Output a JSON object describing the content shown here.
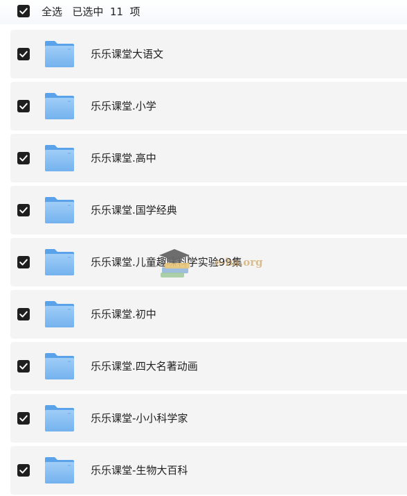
{
  "header": {
    "select_all_label": "全选",
    "selected_text": "已选中  11  项",
    "select_all_checked": true
  },
  "files": [
    {
      "name": "乐乐课堂大语文",
      "checked": true
    },
    {
      "name": "乐乐课堂.小学",
      "checked": true
    },
    {
      "name": "乐乐课堂.高中",
      "checked": true
    },
    {
      "name": "乐乐课堂.国学经典",
      "checked": true
    },
    {
      "name": "乐乐课堂.儿童趣味科学实验99集",
      "checked": true
    },
    {
      "name": "乐乐课堂.初中",
      "checked": true
    },
    {
      "name": "乐乐课堂.四大名著动画",
      "checked": true
    },
    {
      "name": "乐乐课堂-小小科学家",
      "checked": true
    },
    {
      "name": "乐乐课堂-生物大百科",
      "checked": true
    }
  ],
  "watermark": {
    "text": "e-ba.org"
  },
  "icons": {
    "checkbox": "checkbox-checked-icon",
    "folder": "folder-icon",
    "watermark": "graduation-cap-logo"
  },
  "colors": {
    "row_background": "#f4f4f5",
    "checkbox_fill": "#1f1f1f",
    "folder_blue": "#7cb8f2"
  }
}
